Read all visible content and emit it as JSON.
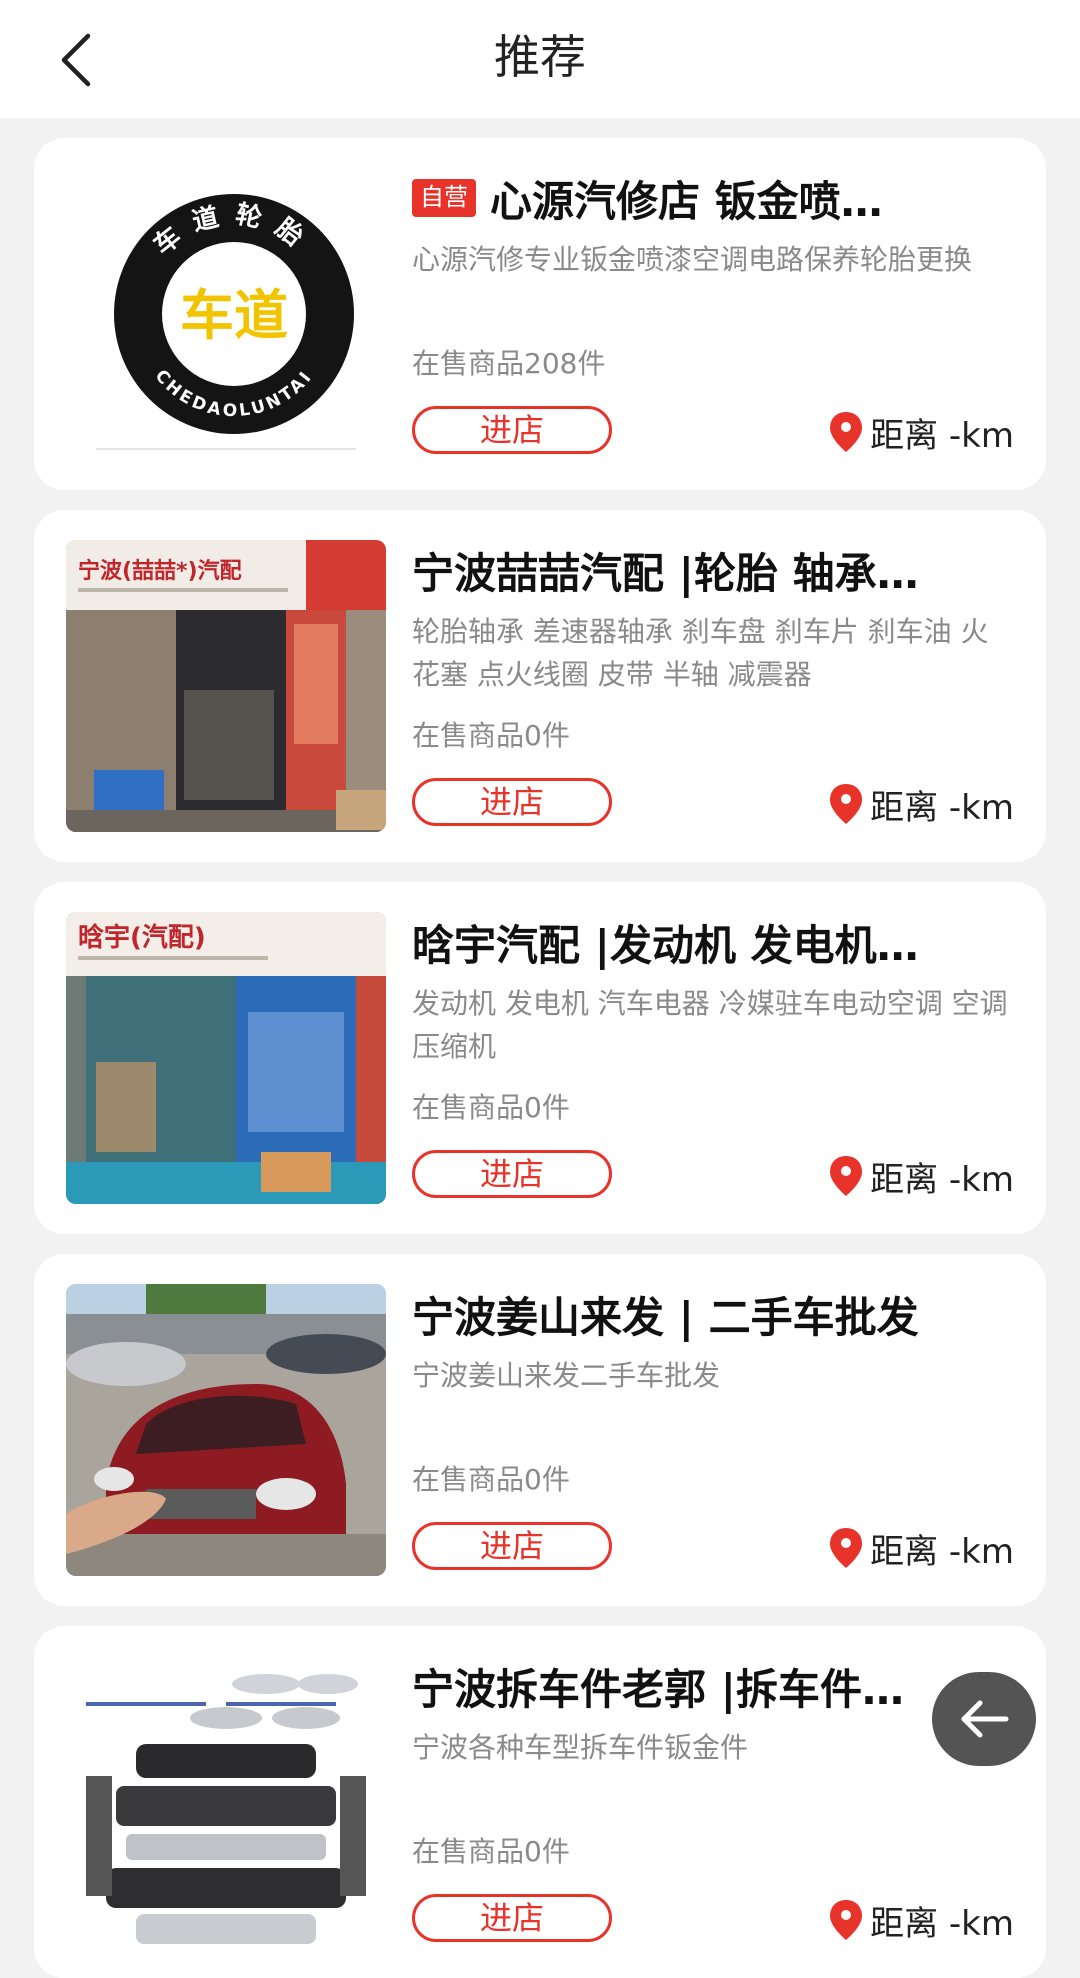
{
  "header": {
    "title": "推荐"
  },
  "labels": {
    "enter": "进店",
    "self_operated": "自营"
  },
  "colors": {
    "accent": "#e8332b",
    "background": "#f2f2f2"
  },
  "shops": [
    {
      "name": "心源汽修店 钣金喷…",
      "self_operated": true,
      "description": "心源汽修专业钣金喷漆空调电路保养轮胎更换",
      "goods_count": "在售商品208件",
      "distance": "距离 -km",
      "thumb": "tire-logo",
      "logo_text_top": "车道轮胎",
      "logo_text_center": "车道",
      "logo_text_bottom": "CHEDAOLUNTAI"
    },
    {
      "name": "宁波喆喆汽配 |轮胎 轴承…",
      "self_operated": false,
      "description": "轮胎轴承 差速器轴承 刹车盘 刹车片 刹车油 火花塞 点火线圈 皮带 半轴 减震器",
      "goods_count": "在售商品0件",
      "distance": "距离 -km",
      "thumb": "storefront-photo",
      "sign_text": "宁波(喆喆*)汽配"
    },
    {
      "name": "晗宇汽配 |发动机 发电机…",
      "self_operated": false,
      "description": "发动机 发电机 汽车电器 冷媒驻车电动空调 空调压缩机",
      "goods_count": "在售商品0件",
      "distance": "距离 -km",
      "thumb": "storefront-photo",
      "sign_text": "晗宇(汽配)"
    },
    {
      "name": "宁波姜山来发 | 二手车批发",
      "self_operated": false,
      "description": "宁波姜山来发二手车批发",
      "goods_count": "在售商品0件",
      "distance": "距离 -km",
      "thumb": "car-photo"
    },
    {
      "name": "宁波拆车件老郭 |拆车件…",
      "self_operated": false,
      "description": "宁波各种车型拆车件钣金件",
      "goods_count": "在售商品0件",
      "distance": "距离 -km",
      "thumb": "parts-photo"
    }
  ]
}
